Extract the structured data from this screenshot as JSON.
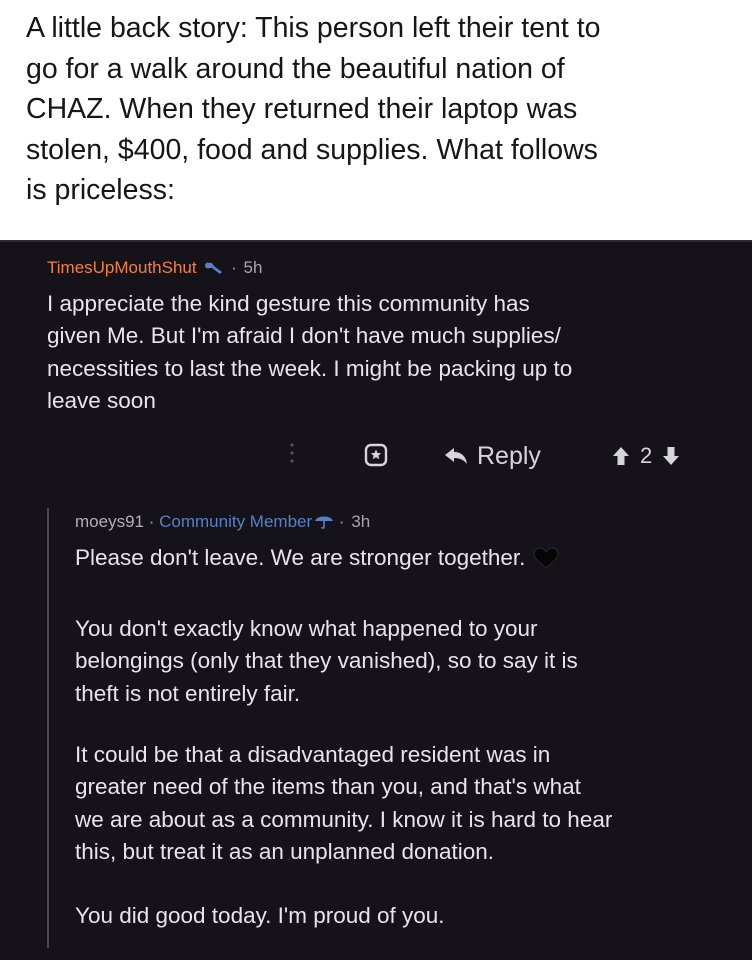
{
  "caption": {
    "lines": [
      "A little back story: This person left their tent to",
      "go for a walk around the beautiful nation of",
      "CHAZ. When they returned their laptop was",
      "stolen, $400, food and supplies. What follows",
      "is priceless:"
    ]
  },
  "comment": {
    "username": "TimesUpMouthShut",
    "separator": "·",
    "age": "5h",
    "body_lines": [
      "I appreciate the kind gesture this community has",
      "given Me. But I'm afraid I don't have much supplies/",
      "necessities to last the week. I might be packing up to",
      "leave soon"
    ],
    "reply_label": "Reply",
    "score": "2"
  },
  "reply": {
    "username": "moeys91",
    "separator": "·",
    "flair": "Community Member",
    "age": "3h",
    "paragraphs": [
      [
        "Please don't leave. We are stronger together."
      ],
      [
        "You don't exactly know what happened to your",
        "belongings (only that they vanished), so to say it is",
        "theft is not entirely fair."
      ],
      [
        "It could be that a disadvantaged resident was in",
        "greater need of the items than you, and that's what",
        "we are about as a community. I know it is hard to hear",
        "this, but treat it as an unplanned donation."
      ],
      [
        "You did good today. I'm proud of you."
      ]
    ]
  },
  "icons": {
    "flair_icon": "wrench-icon",
    "more": "more-vertical-icon",
    "award": "award-icon",
    "reply": "reply-arrow-icon",
    "upvote": "upvote-icon",
    "downvote": "downvote-icon",
    "reply_flair_icon": "umbrella-icon",
    "heart": "black-heart-icon"
  },
  "colors": {
    "background": "#151319",
    "username": "#f0803e",
    "flair": "#5a7fc7",
    "body_text": "#e6e6ea",
    "muted": "#a7a6ad"
  }
}
